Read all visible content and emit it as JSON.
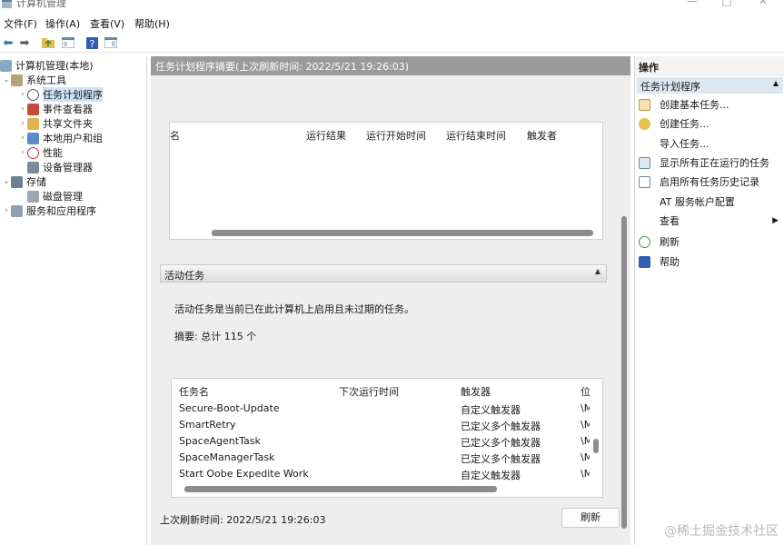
{
  "window": {
    "title": "计算机管理",
    "minimize": "—",
    "maximize": "□",
    "close": "✕"
  },
  "menu": [
    "文件(F)",
    "操作(A)",
    "查看(V)",
    "帮助(H)"
  ],
  "toolbar": [
    "back-icon",
    "forward-icon",
    "folder-up-icon",
    "console-icon",
    "help-icon",
    "panel-icon"
  ],
  "tree": {
    "root": "计算机管理(本地)",
    "system_tools": "系统工具",
    "task_scheduler": "任务计划程序",
    "event_viewer": "事件查看器",
    "shared_folders": "共享文件夹",
    "local_users": "本地用户和组",
    "performance": "性能",
    "device_manager": "设备管理器",
    "storage": "存储",
    "disk_management": "磁盘管理",
    "services_apps": "服务和应用程序"
  },
  "middle": {
    "header": "任务计划程序摘要(上次刷新时间: 2022/5/21 19:26:03)",
    "top_table_columns": [
      "名",
      "运行结果",
      "运行开始时间",
      "运行结束时间",
      "触发者"
    ],
    "active_section": "活动任务",
    "active_desc": "活动任务是当前已在此计算机上启用且未过期的任务。",
    "summary": "摘要: 总计 115 个",
    "task_columns": [
      "任务名",
      "下次运行时间",
      "触发器",
      "位"
    ],
    "tasks": [
      {
        "name": "Secure-Boot-Update",
        "next": "",
        "trigger": "自定义触发器",
        "loc": "\\M"
      },
      {
        "name": "SmartRetry",
        "next": "",
        "trigger": "已定义多个触发器",
        "loc": "\\M"
      },
      {
        "name": "SpaceAgentTask",
        "next": "",
        "trigger": "已定义多个触发器",
        "loc": "\\M"
      },
      {
        "name": "SpaceManagerTask",
        "next": "",
        "trigger": "已定义多个触发器",
        "loc": "\\M"
      },
      {
        "name": "Start Oobe Expedite Work",
        "next": "",
        "trigger": "自定义触发器",
        "loc": "\\M"
      }
    ],
    "last_refresh": "上次刷新时间: 2022/5/21 19:26:03",
    "refresh_button": "刷新"
  },
  "actions": {
    "header": "操作",
    "section": "任务计划程序",
    "items": [
      {
        "label": "创建基本任务...",
        "icon": "basic-task-icon"
      },
      {
        "label": "创建任务...",
        "icon": "task-icon"
      },
      {
        "label": "导入任务...",
        "icon": ""
      },
      {
        "label": "显示所有正在运行的任务",
        "icon": "running-tasks-icon"
      },
      {
        "label": "启用所有任务历史记录",
        "icon": "history-icon"
      },
      {
        "label": "AT 服务帐户配置",
        "icon": ""
      },
      {
        "label": "查看",
        "icon": ""
      },
      {
        "label": "刷新",
        "icon": "refresh-icon"
      },
      {
        "label": "帮助",
        "icon": "help-icon"
      }
    ]
  },
  "brand_watermark": "@稀土掘金技术社区"
}
